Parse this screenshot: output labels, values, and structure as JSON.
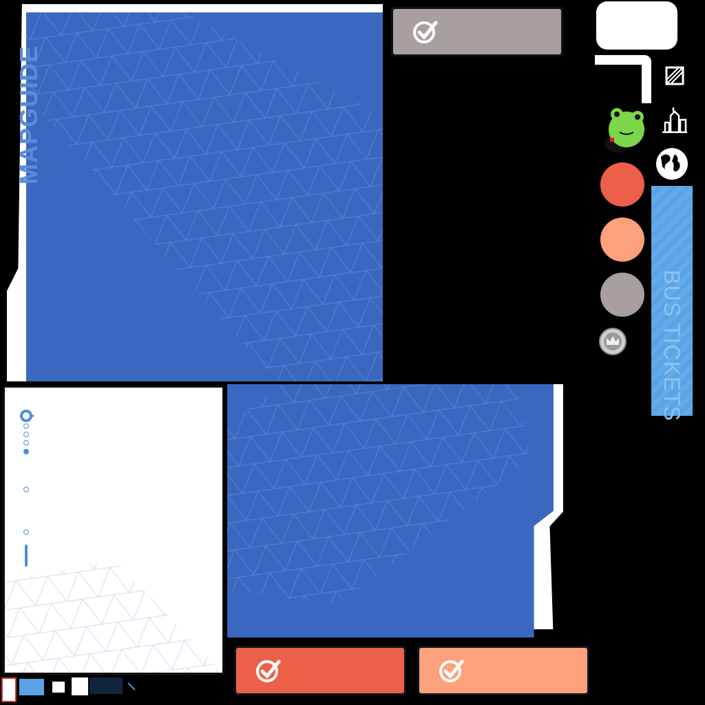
{
  "atlas": {
    "title_vertical": "MAPGUIDE",
    "bus_tickets_label": "BUS TICKETS",
    "colors": {
      "blue_panel": "#3a67bf",
      "grid_line": "#5c86d2",
      "gray_button": "#a8a09f",
      "red_button": "#ec604a",
      "salmon_button": "#fda07c",
      "circle_red": "#ec604a",
      "circle_salmon": "#fda07c",
      "circle_gray": "#a8a09f",
      "ticket_blue": "#5aa3e6",
      "white": "#ffffff"
    },
    "icons": {
      "check": "check-circle-icon",
      "frog": "frog-mascot-icon",
      "globe": "globe-icon",
      "city": "city-skyline-icon",
      "crown_coin": "crown-coin-icon",
      "location": "location-pin-icon"
    }
  }
}
